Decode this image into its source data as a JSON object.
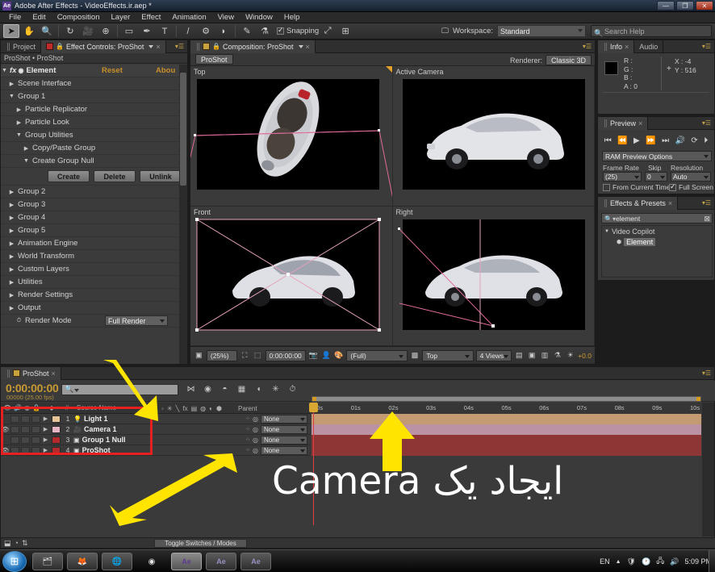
{
  "window": {
    "app_badge": "Ae",
    "title": "Adobe After Effects - VideoEffects.ir.aep *",
    "minimize": "—",
    "maximize": "❐",
    "close": "✕"
  },
  "menu": [
    "File",
    "Edit",
    "Composition",
    "Layer",
    "Effect",
    "Animation",
    "View",
    "Window",
    "Help"
  ],
  "toolbar": {
    "tools": [
      {
        "name": "selection-tool",
        "glyph": "➤",
        "selected": true
      },
      {
        "name": "hand-tool",
        "glyph": "✋",
        "selected": false
      },
      {
        "name": "zoom-tool",
        "glyph": "🔍",
        "selected": false
      },
      {
        "name": "rotation-tool",
        "glyph": "↻",
        "selected": false
      },
      {
        "name": "camera-tool",
        "glyph": "🎥",
        "selected": false
      },
      {
        "name": "pan-behind-tool",
        "glyph": "⊕",
        "selected": false
      },
      {
        "name": "shape-tool",
        "glyph": "▭",
        "selected": false
      },
      {
        "name": "pen-tool",
        "glyph": "✒",
        "selected": false
      },
      {
        "name": "text-tool",
        "glyph": "T",
        "selected": false
      },
      {
        "name": "brush-tool",
        "glyph": "/",
        "selected": false
      },
      {
        "name": "clone-stamp-tool",
        "glyph": "⚙",
        "selected": false
      },
      {
        "name": "eraser-tool",
        "glyph": "◗",
        "selected": false
      },
      {
        "name": "roto-brush-tool",
        "glyph": "✎",
        "selected": false
      },
      {
        "name": "puppet-tool",
        "glyph": "⚗",
        "selected": false
      }
    ],
    "snapping_label": "Snapping",
    "snapping_checked": true,
    "workspace_label": "Workspace:",
    "workspace_value": "Standard",
    "search_help_placeholder": "Search Help"
  },
  "effect_controls": {
    "tab_project": "Project",
    "tab_title": "Effect Controls: ProShot",
    "breadcrumb": "ProShot • ProShot",
    "effect_name": "Element",
    "reset": "Reset",
    "about": "Abou",
    "rows": [
      {
        "label": "Scene Interface",
        "indent": 1,
        "tri": "▶"
      },
      {
        "label": "Group 1",
        "indent": 1,
        "tri": "▼"
      },
      {
        "label": "Particle Replicator",
        "indent": 2,
        "tri": "▶"
      },
      {
        "label": "Particle Look",
        "indent": 2,
        "tri": "▶"
      },
      {
        "label": "Group Utilities",
        "indent": 2,
        "tri": "▼"
      },
      {
        "label": "Copy/Paste Group",
        "indent": 3,
        "tri": "▶"
      },
      {
        "label": "Create Group Null",
        "indent": 3,
        "tri": "▼"
      }
    ],
    "buttons": [
      "Create",
      "Delete",
      "Unlink"
    ],
    "rows_after": [
      {
        "label": "Group 2",
        "indent": 1,
        "tri": "▶"
      },
      {
        "label": "Group 3",
        "indent": 1,
        "tri": "▶"
      },
      {
        "label": "Group 4",
        "indent": 1,
        "tri": "▶"
      },
      {
        "label": "Group 5",
        "indent": 1,
        "tri": "▶"
      },
      {
        "label": "Animation Engine",
        "indent": 1,
        "tri": "▶"
      },
      {
        "label": "World Transform",
        "indent": 1,
        "tri": "▶"
      },
      {
        "label": "Custom Layers",
        "indent": 1,
        "tri": "▶"
      },
      {
        "label": "Utilities",
        "indent": 1,
        "tri": "▶"
      },
      {
        "label": "Render Settings",
        "indent": 1,
        "tri": "▶"
      },
      {
        "label": "Output",
        "indent": 1,
        "tri": "▶"
      }
    ],
    "render_mode_label": "Render Mode",
    "render_mode_value": "Full Render"
  },
  "composition": {
    "tab_title": "Composition: ProShot",
    "comp_pill": "ProShot",
    "renderer_label": "Renderer:",
    "renderer_value": "Classic 3D",
    "viewports": [
      {
        "label": "Top",
        "active": true
      },
      {
        "label": "Active Camera",
        "active": false
      },
      {
        "label": "Front",
        "active": false
      },
      {
        "label": "Right",
        "active": false
      }
    ],
    "viewer_bar": {
      "zoom": "(25%)",
      "timecode": "0:00:00:00",
      "resolution": "(Full)",
      "view": "Top",
      "views_count": "4 Views",
      "exposure": "+0.0"
    }
  },
  "info_panel": {
    "tab": "Info",
    "tab_audio": "Audio",
    "r": "R :",
    "g": "G :",
    "b": "B :",
    "a": "A : 0",
    "x": "X : -4",
    "y": "Y : 516"
  },
  "preview_panel": {
    "tab": "Preview",
    "transport": [
      "⏮",
      "⏪",
      "▶",
      "⏩",
      "⏭",
      "🔊",
      "⟳",
      "⏵"
    ],
    "ram_preview_options": "RAM Preview Options",
    "frame_rate_label": "Frame Rate",
    "frame_rate_value": "(25)",
    "skip_label": "Skip",
    "skip_value": "0",
    "resolution_label": "Resolution",
    "resolution_value": "Auto",
    "from_current_time": "From Current Time",
    "from_current_checked": false,
    "full_screen": "Full Screen",
    "full_screen_checked": true
  },
  "effects_presets": {
    "tab": "Effects & Presets",
    "search_value": "element",
    "category": "Video Copilot",
    "item": "Element"
  },
  "timeline": {
    "tab": "ProShot",
    "timecode": "0:00:00:00",
    "frames": "00000 (25.00 fps)",
    "columns": {
      "num": "#",
      "source_name": "Source Name",
      "parent": "Parent"
    },
    "layers": [
      {
        "num": "1",
        "name": "Light 1",
        "color": "#e8c49a",
        "eye": false,
        "icon": "💡",
        "parent": "None",
        "bar": "#c49a72"
      },
      {
        "num": "2",
        "name": "Camera 1",
        "color": "#e8b6c4",
        "eye": true,
        "icon": "🎥",
        "parent": "None",
        "bar": "#bb92a3"
      },
      {
        "num": "3",
        "name": "Group 1 Null",
        "color": "#b52b2b",
        "eye": false,
        "icon": "▣",
        "parent": "None",
        "bar": "#8e3636"
      },
      {
        "num": "4",
        "name": "ProShot",
        "color": "#b52b2b",
        "eye": true,
        "icon": "▣",
        "parent": "None",
        "bar": "#8e3636"
      }
    ],
    "ruler_ticks": [
      "00s",
      "01s",
      "02s",
      "03s",
      "04s",
      "05s",
      "06s",
      "07s",
      "08s",
      "09s",
      "10s"
    ],
    "toggle_switches": "Toggle Switches / Modes"
  },
  "annotation": {
    "overlay_text": "ایجاد یک Camera",
    "arrow_color": "#ffe400",
    "highlight_color": "#e8201f"
  },
  "taskbar": {
    "start": "⊞",
    "items": [
      {
        "name": "explorer",
        "glyph": "🗂",
        "style": "normal"
      },
      {
        "name": "firefox",
        "glyph": "🦊",
        "style": "normal"
      },
      {
        "name": "internet-explorer",
        "glyph": "🌐",
        "style": "normal"
      },
      {
        "name": "media-player",
        "glyph": "◉",
        "style": "flat"
      },
      {
        "name": "after-effects-active",
        "glyph": "Ae",
        "style": "lit"
      },
      {
        "name": "after-effects-2",
        "glyph": "Ae",
        "style": "normal"
      },
      {
        "name": "after-effects-3",
        "glyph": "Ae",
        "style": "normal"
      }
    ],
    "language": "EN",
    "tray": [
      "🛡",
      "🕐",
      "🖧",
      "🔊"
    ],
    "clock": "5:09 PM"
  }
}
